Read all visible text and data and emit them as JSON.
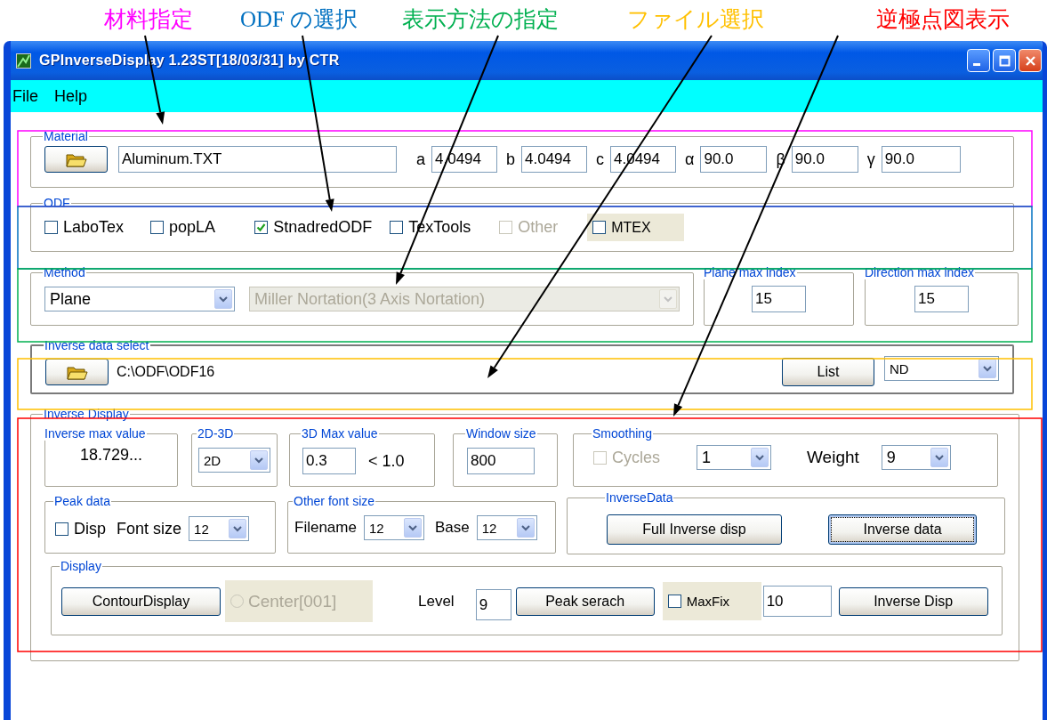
{
  "annotations": [
    {
      "text": "材料指定",
      "color": "#ff00ff"
    },
    {
      "text": "ODF の選択",
      "color": "#0070c0"
    },
    {
      "text": "表示方法の指定",
      "color": "#00b050"
    },
    {
      "text": "ファイル選択",
      "color": "#ffc000"
    },
    {
      "text": "逆極点図表示",
      "color": "#ff0000"
    }
  ],
  "window": {
    "title": "GPInverseDisplay 1.23ST[18/03/31] by CTR"
  },
  "menu": [
    "File",
    "Help"
  ],
  "material": {
    "legend": "Material",
    "file": "Aluminum.TXT",
    "params": [
      {
        "label": "a",
        "value": "4.0494"
      },
      {
        "label": "b",
        "value": "4.0494"
      },
      {
        "label": "c",
        "value": "4.0494"
      },
      {
        "label": "α",
        "value": "90.0"
      },
      {
        "label": "β",
        "value": "90.0"
      },
      {
        "label": "γ",
        "value": "90.0"
      }
    ]
  },
  "odf": {
    "legend": "ODF",
    "options": [
      {
        "label": "LaboTex",
        "checked": false,
        "disabled": false,
        "kind": "plain"
      },
      {
        "label": "popLA",
        "checked": false,
        "disabled": false,
        "kind": "plain"
      },
      {
        "label": "StnadredODF",
        "checked": true,
        "disabled": false,
        "kind": "plain"
      },
      {
        "label": "TexTools",
        "checked": false,
        "disabled": false,
        "kind": "plain"
      },
      {
        "label": "Other",
        "checked": false,
        "disabled": true,
        "kind": "plain"
      },
      {
        "label": "MTEX",
        "checked": false,
        "disabled": false,
        "kind": "panel"
      }
    ]
  },
  "method": {
    "legend": "Method",
    "mode": "Plane",
    "notation": {
      "value": "Miller Nortation(3 Axis Nortation)",
      "disabled": true
    }
  },
  "plane_max": {
    "legend": "Plane max index",
    "value": "15"
  },
  "direction_max": {
    "legend": "Direction max index",
    "value": "15"
  },
  "inverse_data_select": {
    "legend": "Inverse data select",
    "path": "C:\\ODF\\ODF16",
    "list_button": "List",
    "axis": "ND"
  },
  "inverse_display": {
    "legend": "Inverse Display",
    "max_value": {
      "legend": "Inverse max value",
      "value": "18.729..."
    },
    "dimension": {
      "legend": "2D-3D",
      "value": "2D"
    },
    "max_3d": {
      "legend": "3D Max value",
      "value": "0.3",
      "note": "< 1.0"
    },
    "window_size": {
      "legend": "Window size",
      "value": "800"
    },
    "smoothing": {
      "legend": "Smoothing",
      "cycles": {
        "label": "Cycles",
        "checked": false,
        "disabled": true
      },
      "cycles_value": "1",
      "weight_label": "Weight",
      "weight_value": "9"
    },
    "peak_data": {
      "legend": "Peak data",
      "disp": {
        "label": "Disp",
        "checked": false,
        "disabled": false
      },
      "font_size_label": "Font size",
      "font_size": "12"
    },
    "other_font": {
      "legend": "Other font size",
      "filename_label": "Filename",
      "filename": "12",
      "base_label": "Base",
      "base": "12"
    },
    "inverse_data": {
      "legend": "InverseData",
      "buttons": [
        {
          "label": "Full Inverse disp",
          "focused": false
        },
        {
          "label": "Inverse data",
          "focused": true
        }
      ]
    },
    "display": {
      "legend": "Display",
      "contour_button": "ContourDisplay",
      "center": {
        "label": "Center[001]",
        "selected": false,
        "disabled": true
      },
      "level_label": "Level",
      "level": "9",
      "peak_button": "Peak serach",
      "maxfix": {
        "label": "MaxFix",
        "checked": false,
        "disabled": false
      },
      "maxfix_value": "10",
      "inverse_button": "Inverse Disp"
    }
  }
}
